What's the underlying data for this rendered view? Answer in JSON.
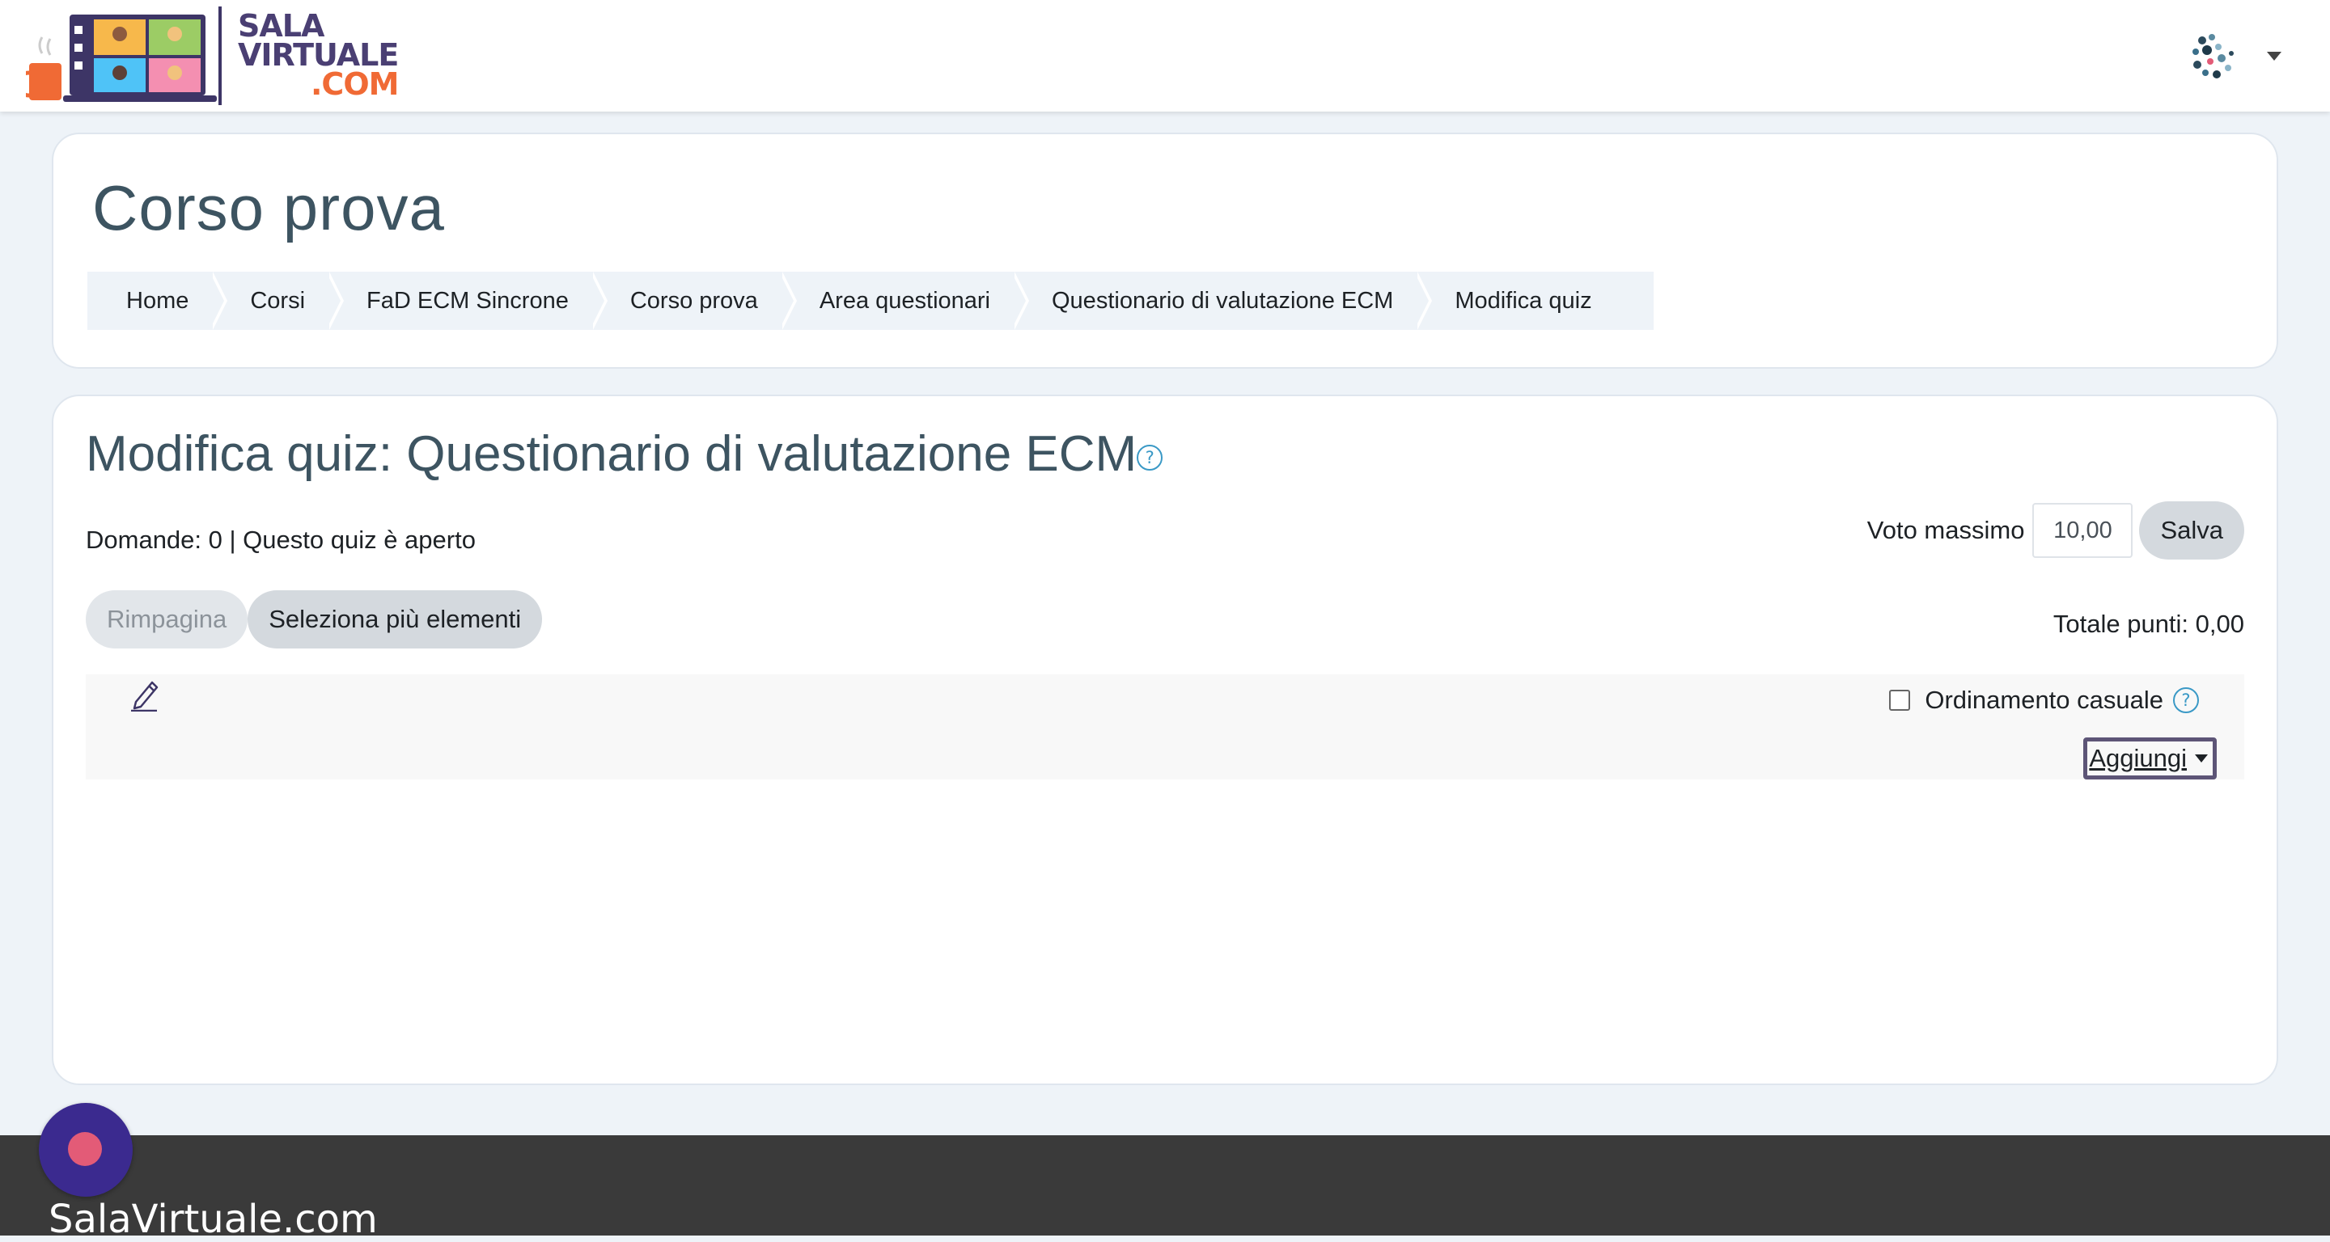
{
  "navbar": {
    "brand_line1": "SALA",
    "brand_line2": "VIRTUALE",
    "brand_line3": ".COM"
  },
  "page": {
    "course_title": "Corso prova",
    "breadcrumb": [
      "Home",
      "Corsi",
      "FaD ECM Sincrone",
      "Corso prova",
      "Area questionari",
      "Questionario di valutazione ECM",
      "Modifica quiz"
    ]
  },
  "quiz": {
    "title": "Modifica quiz: Questionario di valutazione ECM",
    "status": "Domande: 0 | Questo quiz è aperto",
    "max_grade_label": "Voto massimo",
    "max_grade_value": "10,00",
    "save_label": "Salva",
    "repaginate_label": "Rimpagina",
    "select_multiple_label": "Seleziona più elementi",
    "total_points": "Totale punti: 0,00",
    "shuffle_label": "Ordinamento casuale",
    "add_label": "Aggiungi",
    "help_glyph": "?"
  },
  "footer": {
    "brand": "SalaVirtuale.com"
  },
  "colors": {
    "brand_purple": "#4a3f73",
    "brand_orange": "#f06a35",
    "heading": "#3d5461",
    "help_blue": "#3a99c6",
    "footer_bg": "#3a3a3a",
    "fab_bg": "#3b2a8f",
    "fab_dot": "#e35b77"
  }
}
